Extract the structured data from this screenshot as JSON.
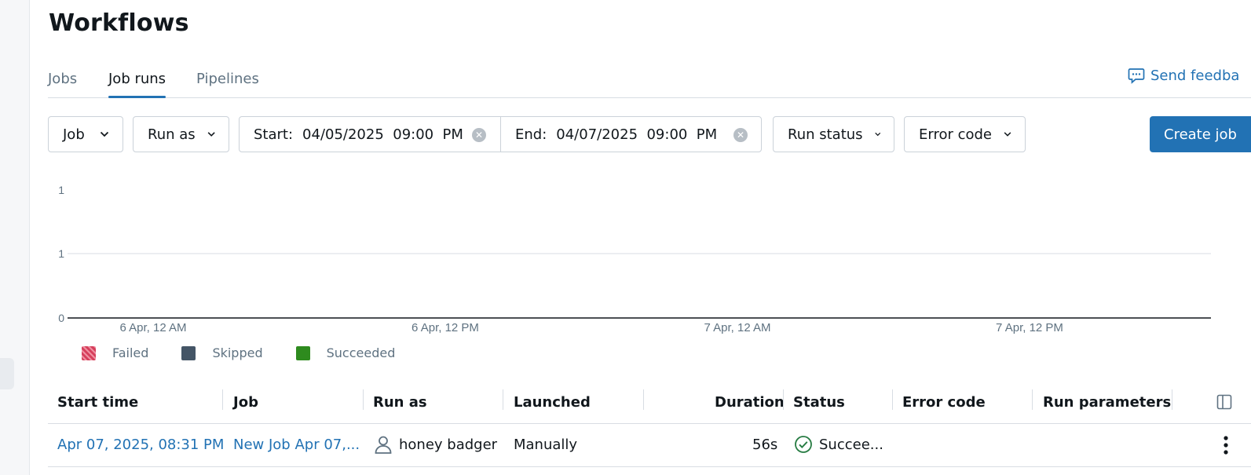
{
  "page": {
    "title": "Workflows"
  },
  "tabs": [
    {
      "label": "Jobs",
      "active": false
    },
    {
      "label": "Job runs",
      "active": true
    },
    {
      "label": "Pipelines",
      "active": false
    }
  ],
  "feedback": {
    "label": "Send feedba",
    "icon": "speech-bubble-icon"
  },
  "filters": {
    "job": "Job",
    "run_as": "Run as",
    "start_label": "Start:",
    "start_value": "04/05/2025  09:00  PM",
    "end_label": "End:",
    "end_value": "04/07/2025  09:00  PM",
    "run_status": "Run status",
    "error_code": "Error code"
  },
  "create_button": {
    "label": "Create job"
  },
  "chart_data": {
    "type": "bar",
    "y_ticks": [
      "1",
      "1",
      "0"
    ],
    "x_ticks": [
      "6 Apr, 12 AM",
      "6 Apr, 12 PM",
      "7 Apr, 12 AM",
      "7 Apr, 12 PM"
    ],
    "series": [
      {
        "name": "Failed",
        "color": "#d63f5c",
        "values": []
      },
      {
        "name": "Skipped",
        "color": "#445566",
        "values": []
      },
      {
        "name": "Succeeded",
        "color": "#2e8b1e",
        "values": []
      }
    ],
    "grid": true,
    "legend_position": "bottom-left"
  },
  "table": {
    "columns": [
      "Start time",
      "Job",
      "Run as",
      "Launched",
      "Duration",
      "Status",
      "Error code",
      "Run parameters"
    ],
    "rows": [
      {
        "start_time": "Apr 07, 2025, 08:31 PM",
        "job": "New Job Apr 07,...",
        "run_as": "honey badger",
        "launched": "Manually",
        "duration": "56s",
        "status": "Succee...",
        "error_code": "",
        "run_parameters": ""
      }
    ]
  },
  "colors": {
    "accent": "#2272b4",
    "success": "#277c43"
  }
}
